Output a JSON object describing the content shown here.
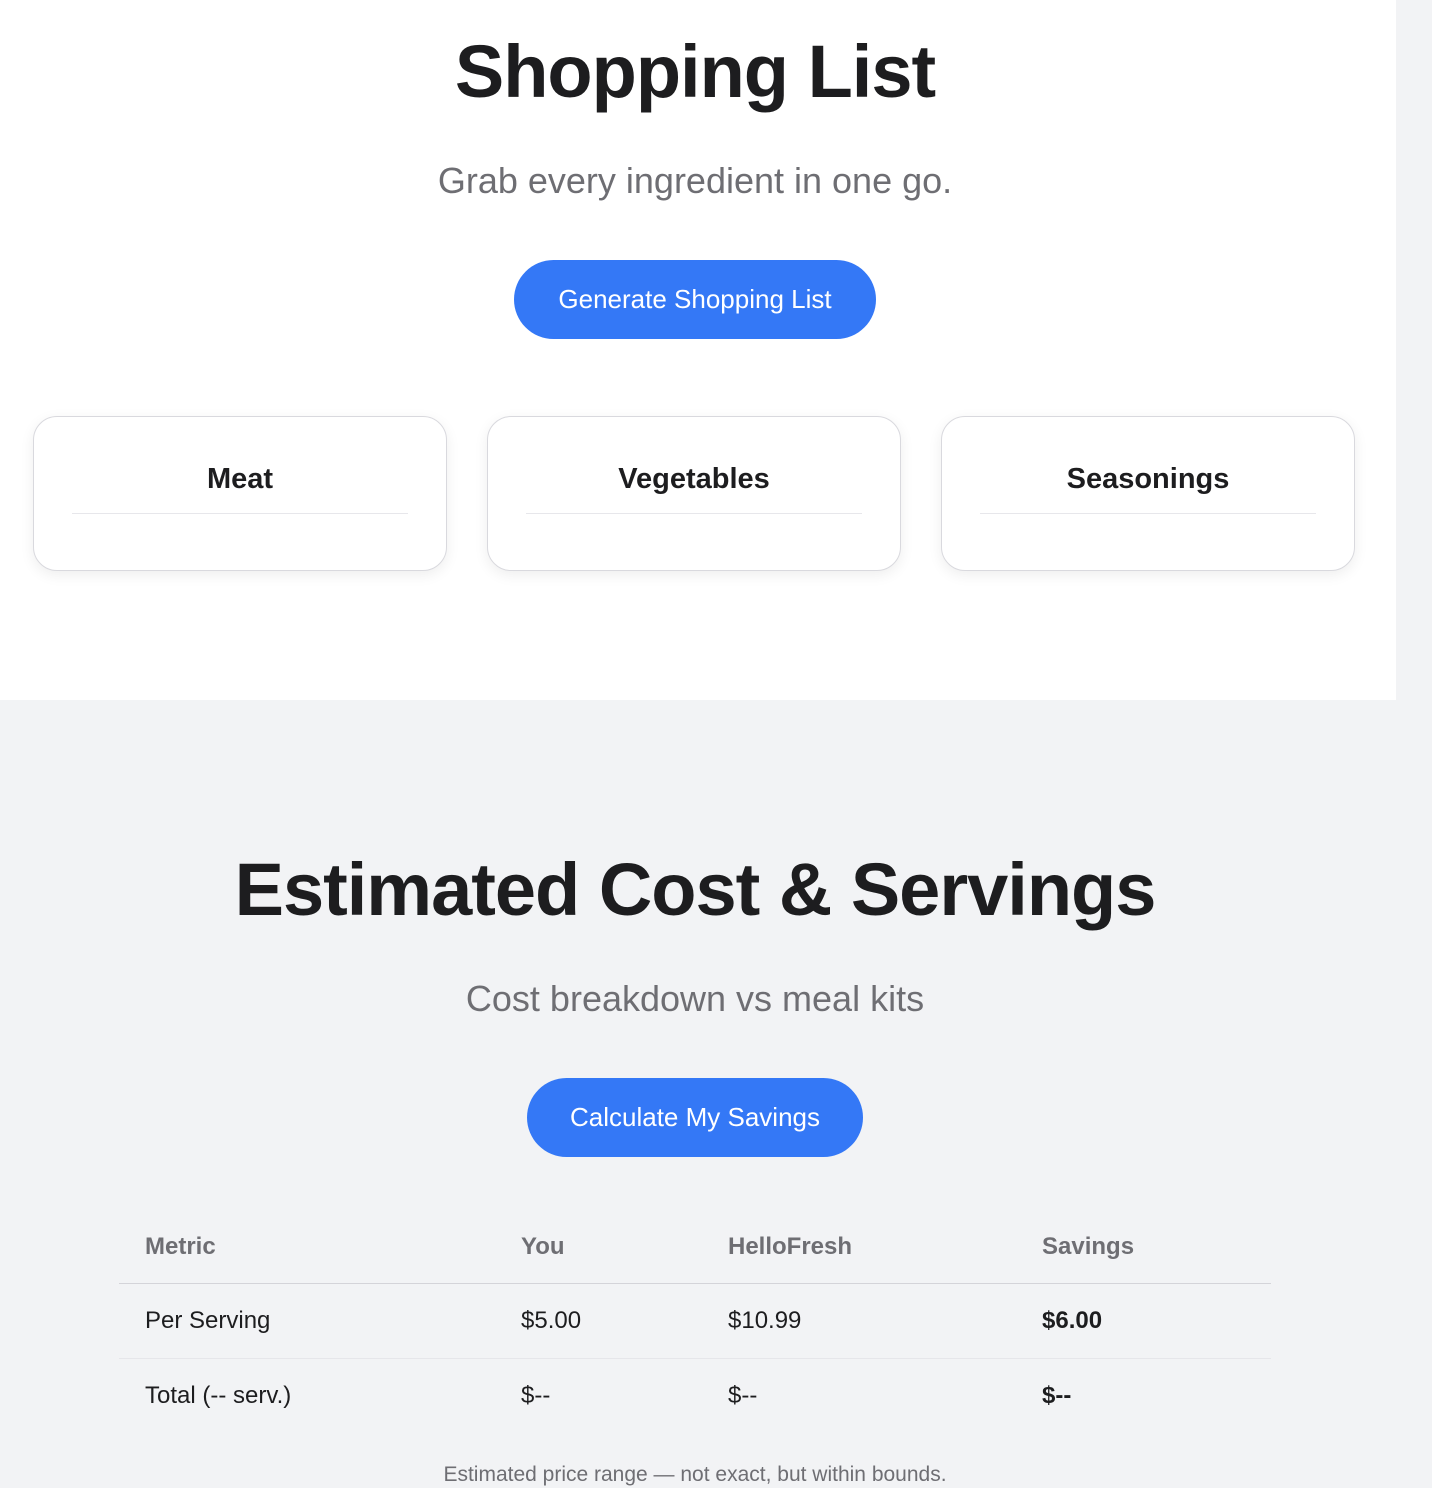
{
  "shopping": {
    "title": "Shopping List",
    "subtitle": "Grab every ingredient in one go.",
    "button_label": "Generate Shopping List",
    "categories": [
      {
        "name": "Meat"
      },
      {
        "name": "Vegetables"
      },
      {
        "name": "Seasonings"
      }
    ]
  },
  "cost": {
    "title": "Estimated Cost & Servings",
    "subtitle": "Cost breakdown vs meal kits",
    "button_label": "Calculate My Savings",
    "table": {
      "headers": [
        "Metric",
        "You",
        "HelloFresh",
        "Savings"
      ],
      "rows": [
        {
          "metric": "Per Serving",
          "you": "$5.00",
          "hellofresh": "$10.99",
          "savings": "$6.00"
        },
        {
          "metric": "Total (-- serv.)",
          "you": "$--",
          "hellofresh": "$--",
          "savings": "$--"
        }
      ]
    },
    "footnote": "Estimated price range — not exact, but within bounds."
  },
  "colors": {
    "accent": "#3478f6",
    "text_primary": "#1d1d1f",
    "text_secondary": "#6e6e73",
    "background": "#f2f3f5",
    "card_background": "#ffffff"
  }
}
